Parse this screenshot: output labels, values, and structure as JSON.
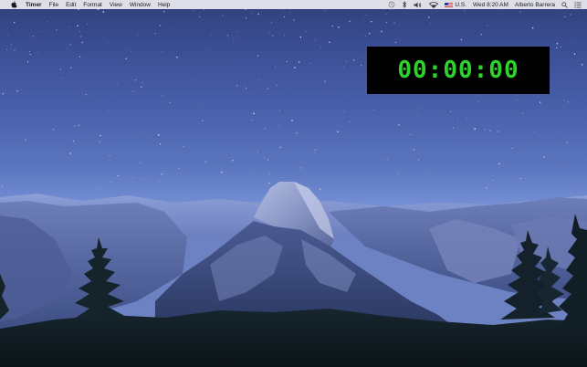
{
  "menubar": {
    "app_name": "Timer",
    "menus": [
      "File",
      "Edit",
      "Format",
      "View",
      "Window",
      "Help"
    ],
    "input_source": "U.S.",
    "clock": "Wed 8:20 AM",
    "user": "Alberto Barrera"
  },
  "timer": {
    "display": "00:00:00",
    "digit_color": "#2ed12e",
    "background_color": "#000000"
  },
  "icons": {
    "apple": "apple-logo-icon",
    "time_machine": "time-machine-icon",
    "bluetooth": "bluetooth-icon",
    "volume": "volume-icon",
    "wifi": "wifi-icon",
    "flag": "us-flag-icon",
    "spotlight": "search-icon",
    "notification_center": "notification-center-icon"
  }
}
